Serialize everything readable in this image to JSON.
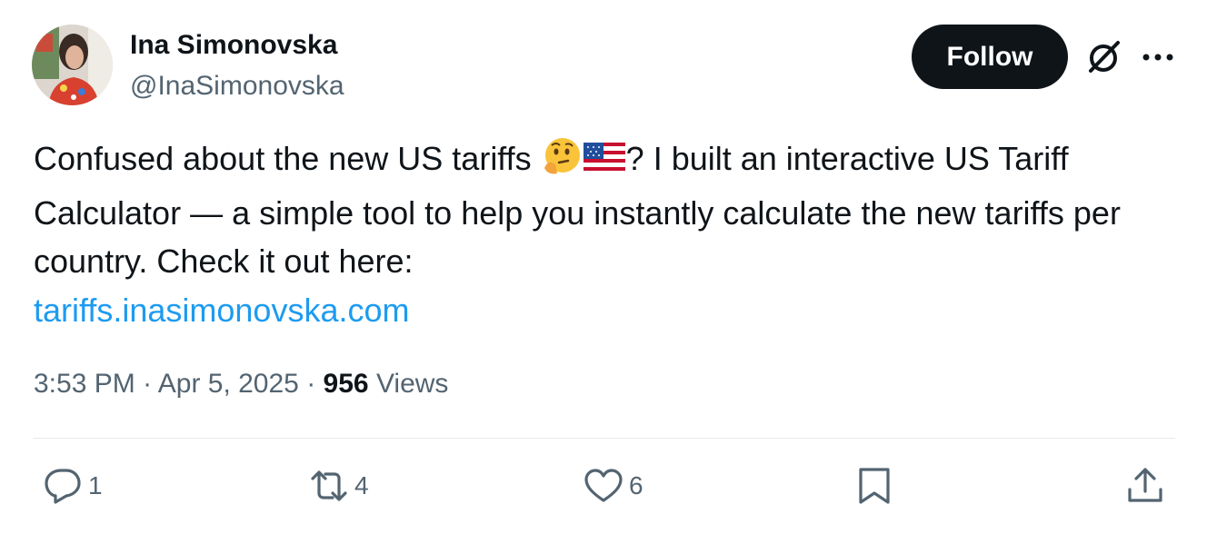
{
  "author": {
    "display_name": "Ina Simonovska",
    "handle": "@InaSimonovska"
  },
  "header": {
    "follow_label": "Follow"
  },
  "tweet": {
    "text_part1": "Confused about the new US tariffs ",
    "text_part2": "? I built an interactive US Tariff Calculator — a simple tool to help you instantly calculate the new tariffs per country. Check it out here:",
    "link": "tariffs.inasimonovska.com",
    "emojis": [
      "thinking-face-emoji",
      "us-flag-emoji"
    ]
  },
  "meta": {
    "time": "3:53 PM",
    "separator": " · ",
    "date": "Apr 5, 2025",
    "views_count": "956",
    "views_label": " Views"
  },
  "actions": {
    "replies": "1",
    "retweets": "4",
    "likes": "6"
  },
  "colors": {
    "link": "#1d9bf0",
    "text": "#0f1419",
    "secondary": "#536471",
    "follow_bg": "#0f1419"
  }
}
